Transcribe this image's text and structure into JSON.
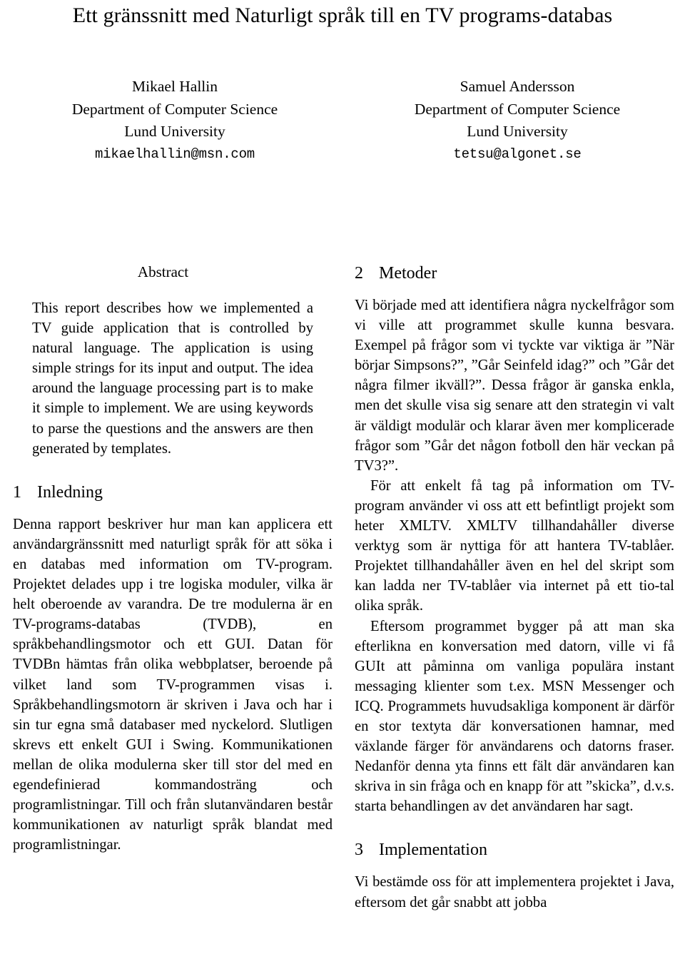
{
  "paper": {
    "title": "Ett gränssnitt med Naturligt språk till en TV programs-databas",
    "authors": [
      {
        "name": "Mikael Hallin",
        "department": "Department of Computer Science",
        "university": "Lund University",
        "email": "mikaelhallin@msn.com"
      },
      {
        "name": "Samuel Andersson",
        "department": "Department of Computer Science",
        "university": "Lund University",
        "email": "tetsu@algonet.se"
      }
    ],
    "abstract": {
      "heading": "Abstract",
      "text": "This report describes how we implemented a TV guide application that is controlled by natural language. The application is using simple strings for its input and output. The idea around the language processing part is to make it simple to implement. We are using keywords to parse the questions and the answers are then generated by templates."
    },
    "sections": [
      {
        "number": "1",
        "title": "Inledning",
        "paragraphs": [
          "Denna rapport beskriver hur man kan applicera ett användargränssnitt med naturligt språk för att söka i en databas med information om TV-program. Projektet delades upp i tre logiska moduler, vilka är helt oberoende av varandra. De tre modulerna är en TV-programs-databas (TVDB), en språkbehandlingsmotor och ett GUI. Datan för TVDBn hämtas från olika webbplatser, beroende på vilket land som TV-programmen visas i. Språkbehandlingsmotorn är skriven i Java och har i sin tur egna små databaser med nyckelord. Slutligen skrevs ett enkelt GUI i Swing. Kommunikationen mellan de olika modulerna sker till stor del med en egendefinierad kommandosträng och programlistningar. Till och från slutanvändaren består kommunikationen av naturligt språk blandat med programlistningar."
        ]
      },
      {
        "number": "2",
        "title": "Metoder",
        "paragraphs": [
          "Vi började med att identifiera några nyckelfrågor som vi ville att programmet skulle kunna besvara. Exempel på frågor som vi tyckte var viktiga är ”När börjar Simpsons?”, ”Går Seinfeld idag?” och ”Går det några filmer ikväll?”. Dessa frågor är ganska enkla, men det skulle visa sig senare att den strategin vi valt är väldigt modulär och klarar även mer komplicerade frågor som ”Går det någon fotboll den här veckan på TV3?”.",
          "För att enkelt få tag på information om TV-program använder vi oss att ett befintligt projekt som heter XMLTV. XMLTV tillhandahåller diverse verktyg som är nyttiga för att hantera TV-tablåer. Projektet tillhandahåller även en hel del skript som kan ladda ner TV-tablåer via internet på ett tio-tal olika språk.",
          "Eftersom programmet bygger på att man ska efterlikna en konversation med datorn, ville vi få GUIt att påminna om vanliga populära instant messaging klienter som t.ex. MSN Messenger och ICQ. Programmets huvudsakliga komponent är därför en stor textyta där konversationen hamnar, med växlande färger för användarens och datorns fraser. Nedanför denna yta finns ett fält där användaren kan skriva in sin fråga och en knapp för att ”skicka”, d.v.s. starta behandlingen av det användaren har sagt."
        ]
      },
      {
        "number": "3",
        "title": "Implementation",
        "paragraphs": [
          "Vi bestämde oss för att implementera projektet i Java, eftersom det går snabbt att jobba"
        ]
      }
    ]
  }
}
